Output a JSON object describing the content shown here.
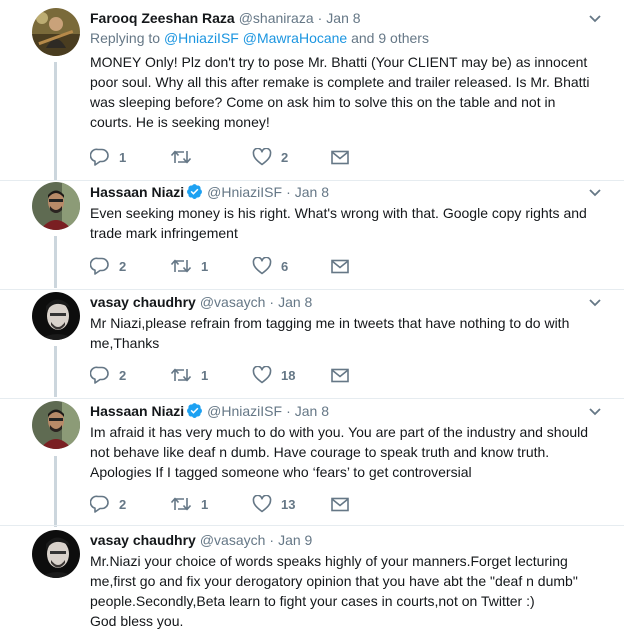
{
  "tweets": [
    {
      "name": "Farooq Zeeshan Raza",
      "verified": false,
      "handle": "@shaniraza",
      "dot": "·",
      "time": "Jan 8",
      "replying": {
        "prefix": "Replying to",
        "mention1": "@HniaziISF",
        "mention2": "@MawraHocane",
        "suffix": "and 9 others"
      },
      "text": "MONEY Only! Plz don't try to pose Mr. Bhatti (Your CLIENT may be) as innocent poor soul. Why all this after remake is complete and trailer released. Is Mr. Bhatti was sleeping before? Come on ask him to solve this on the table and not in courts. He is seeking money!",
      "reply_count": "1",
      "retweet_count": "",
      "like_count": "2"
    },
    {
      "name": "Hassaan Niazi",
      "verified": true,
      "handle": "@HniaziISF",
      "dot": "·",
      "time": "Jan 8",
      "text": "Even seeking money is his right. What's wrong with that. Google copy rights and trade mark infringement",
      "reply_count": "2",
      "retweet_count": "1",
      "like_count": "6"
    },
    {
      "name": "vasay chaudhry",
      "verified": false,
      "handle": "@vasaych",
      "dot": "·",
      "time": "Jan 8",
      "text": "Mr Niazi,please refrain from tagging me in tweets that have nothing to do with me,Thanks",
      "reply_count": "2",
      "retweet_count": "1",
      "like_count": "18"
    },
    {
      "name": "Hassaan Niazi",
      "verified": true,
      "handle": "@HniaziISF",
      "dot": "·",
      "time": "Jan 8",
      "text": "Im afraid it has very much to do with you. You are part of the industry and should not behave like deaf n dumb. Have courage to speak truth and know truth. Apologies If I tagged someone who ‘fears’ to get controversial",
      "reply_count": "2",
      "retweet_count": "1",
      "like_count": "13"
    },
    {
      "name": "vasay chaudhry",
      "verified": false,
      "handle": "@vasaych",
      "dot": "·",
      "time": "Jan 9",
      "text": "Mr.Niazi your choice of words speaks highly of your manners.Forget lecturing me,first go and fix your derogatory opinion that you have  abt the \"deaf n dumb\" people.Secondly,Beta learn to fight your cases in courts,not on Twitter :)\nGod bless you.",
      "reply_count": "",
      "retweet_count": "",
      "like_count": ""
    }
  ],
  "icons": {
    "reply": "reply-icon",
    "retweet": "retweet-icon",
    "like": "heart-icon",
    "dm": "envelope-icon",
    "verified": "verified-badge-icon",
    "menu": "chevron-down-icon"
  },
  "colors": {
    "mention": "#1b95e0",
    "secondary": "#657786",
    "verified": "#1da1f2",
    "thread_line": "#ccd6dd",
    "separator": "#e6ecf0"
  }
}
